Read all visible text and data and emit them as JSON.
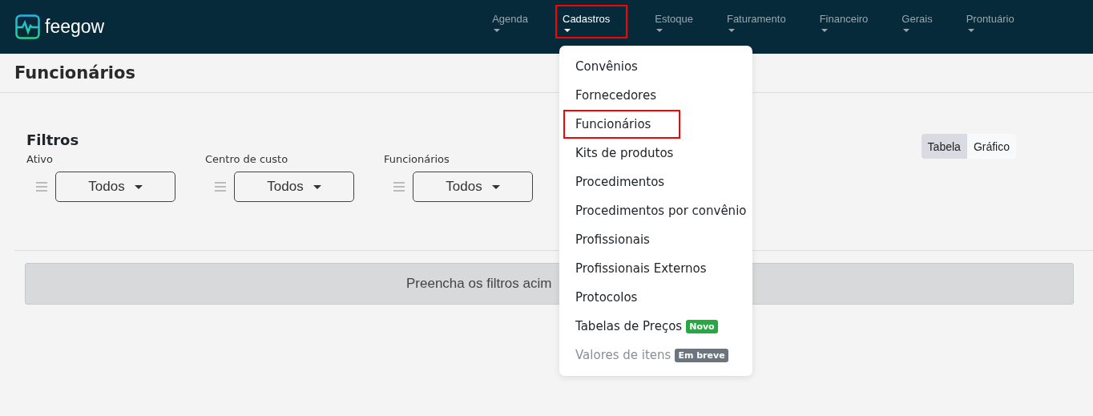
{
  "brand": "feegow",
  "nav": [
    {
      "label": "Agenda",
      "selected": false,
      "highlighted": false
    },
    {
      "label": "Cadastros",
      "selected": true,
      "highlighted": true
    },
    {
      "label": "Estoque",
      "selected": false,
      "highlighted": false
    },
    {
      "label": "Faturamento",
      "selected": false,
      "highlighted": false
    },
    {
      "label": "Financeiro",
      "selected": false,
      "highlighted": false
    },
    {
      "label": "Gerais",
      "selected": false,
      "highlighted": false
    },
    {
      "label": "Prontuário",
      "selected": false,
      "highlighted": false
    }
  ],
  "page_title": "Funcionários",
  "filters": {
    "title": "Filtros",
    "items": [
      {
        "label": "Ativo",
        "value": "Todos"
      },
      {
        "label": "Centro de custo",
        "value": "Todos"
      },
      {
        "label": "Funcionários",
        "value": "Todos"
      }
    ]
  },
  "view_toggle": [
    {
      "label": "Tabela",
      "selected": true
    },
    {
      "label": "Gráfico",
      "selected": false
    }
  ],
  "message": "Preencha os filtros acim",
  "menu": [
    {
      "label": "Convênios",
      "disabled": false,
      "highlighted": false
    },
    {
      "label": "Fornecedores",
      "disabled": false,
      "highlighted": false
    },
    {
      "label": "Funcionários",
      "disabled": false,
      "highlighted": true
    },
    {
      "label": "Kits de produtos",
      "disabled": false,
      "highlighted": false
    },
    {
      "label": "Procedimentos",
      "disabled": false,
      "highlighted": false
    },
    {
      "label": "Procedimentos por convênio",
      "disabled": false,
      "highlighted": false
    },
    {
      "label": "Profissionais",
      "disabled": false,
      "highlighted": false
    },
    {
      "label": "Profissionais Externos",
      "disabled": false,
      "highlighted": false
    },
    {
      "label": "Protocolos",
      "disabled": false,
      "highlighted": false
    },
    {
      "label": "Tabelas de Preços",
      "disabled": false,
      "highlighted": false,
      "badge": {
        "label": "Novo",
        "color": "#28a745"
      }
    },
    {
      "label": "Valores de itens",
      "disabled": true,
      "highlighted": false,
      "badge": {
        "label": "Em breve",
        "color": "#6c757d"
      }
    }
  ]
}
